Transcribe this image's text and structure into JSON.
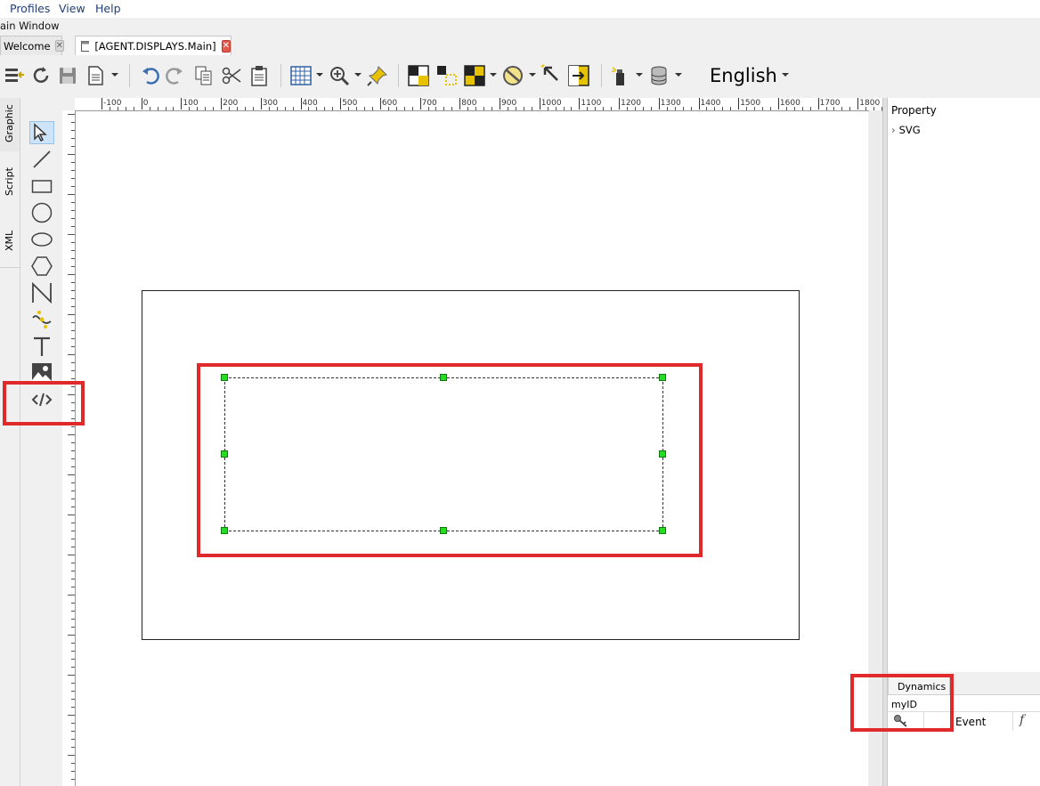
{
  "menu": {
    "profiles": "Profiles",
    "view": "View",
    "help": "Help"
  },
  "window_title": "ain Window",
  "tabs": [
    {
      "label": "Welcome"
    },
    {
      "label": "[AGENT.DISPLAYS.Main]"
    }
  ],
  "toolbar": {
    "language": "English"
  },
  "left_tabs": {
    "graphic": "Graphic",
    "script": "Script",
    "xml": "XML"
  },
  "ruler": {
    "h_labels": [
      "-100",
      "0",
      "100",
      "200",
      "300",
      "400",
      "500",
      "600",
      "700",
      "800",
      "900",
      "1000",
      "1100",
      "1200",
      "1300",
      "1400",
      "1500",
      "1600",
      "1700",
      "1800"
    ]
  },
  "properties": {
    "header": "Property",
    "svg_node": "SVG"
  },
  "dynamics": {
    "tab": "Dynamics",
    "id_value": "myID",
    "event_label": "Event",
    "f_label": "f"
  },
  "colors": {
    "highlight": "#e0292a",
    "handle": "#22dd22",
    "selected_tool": "#cde3f7"
  }
}
